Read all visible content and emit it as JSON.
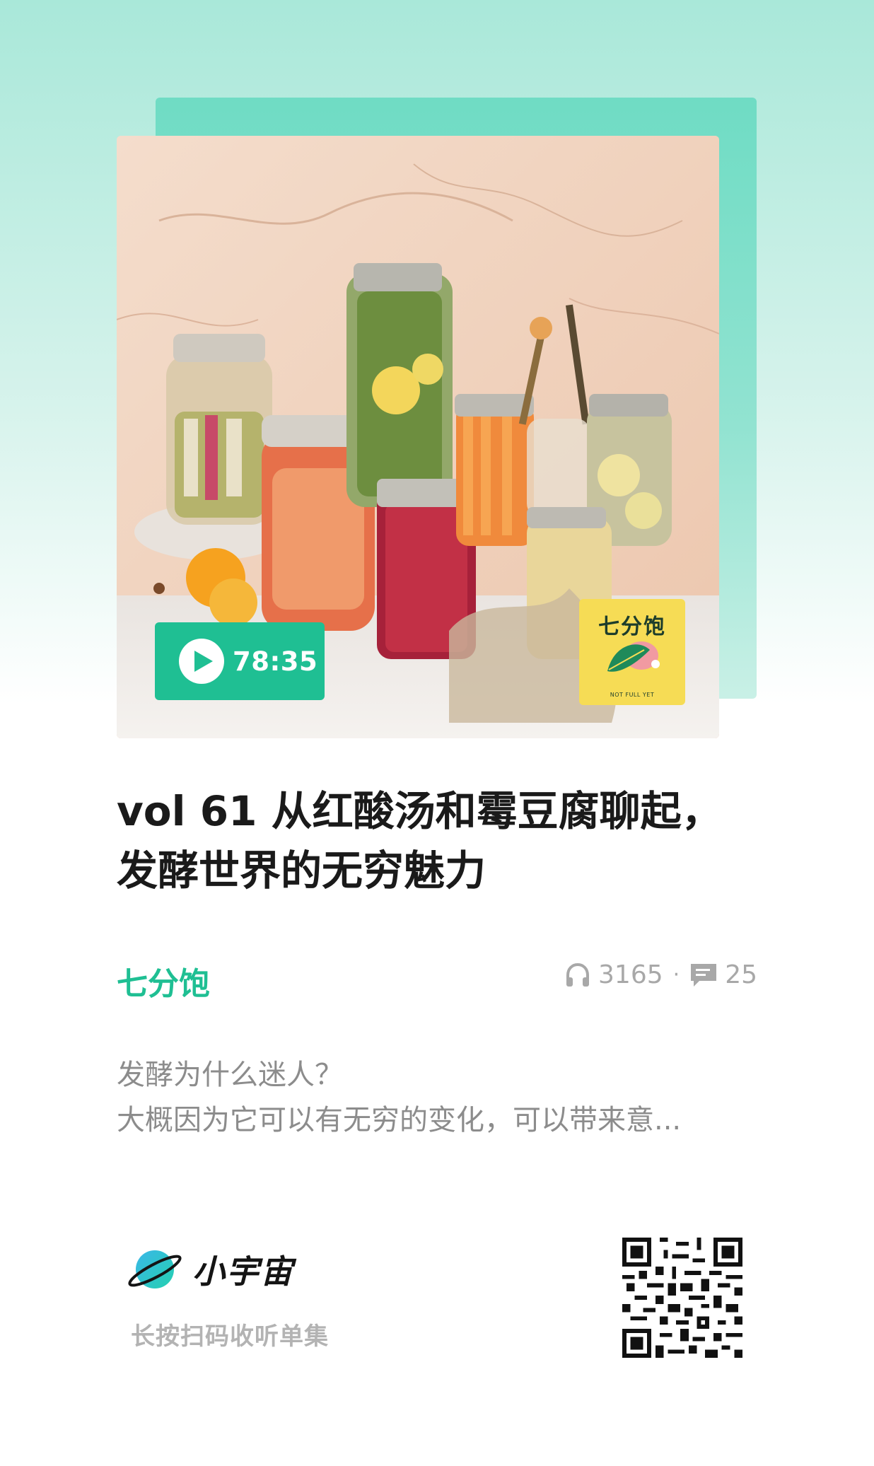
{
  "episode": {
    "duration": "78:35",
    "title": "vol 61 从红酸汤和霉豆腐聊起，发酵世界的无穷魅力",
    "description_line1": "发酵为什么迷人？",
    "description_line2": "大概因为它可以有无穷的变化，可以带来意..."
  },
  "cover": {
    "sticker_title": "七分饱",
    "sticker_subtitle": "NOT FULL YET"
  },
  "podcast": {
    "name": "七分饱",
    "plays": "3165",
    "comments": "25",
    "separator": "·"
  },
  "footer": {
    "app_name": "小宇宙",
    "scan_hint": "长按扫码收听单集"
  },
  "icons": {
    "play": "play-icon",
    "plays": "headphones-icon",
    "comments": "comment-icon",
    "logo": "planet-icon",
    "qr": "qr-code"
  },
  "colors": {
    "accent": "#1fbf93",
    "sticker": "#f6dc55",
    "muted": "#a8a8a8"
  }
}
